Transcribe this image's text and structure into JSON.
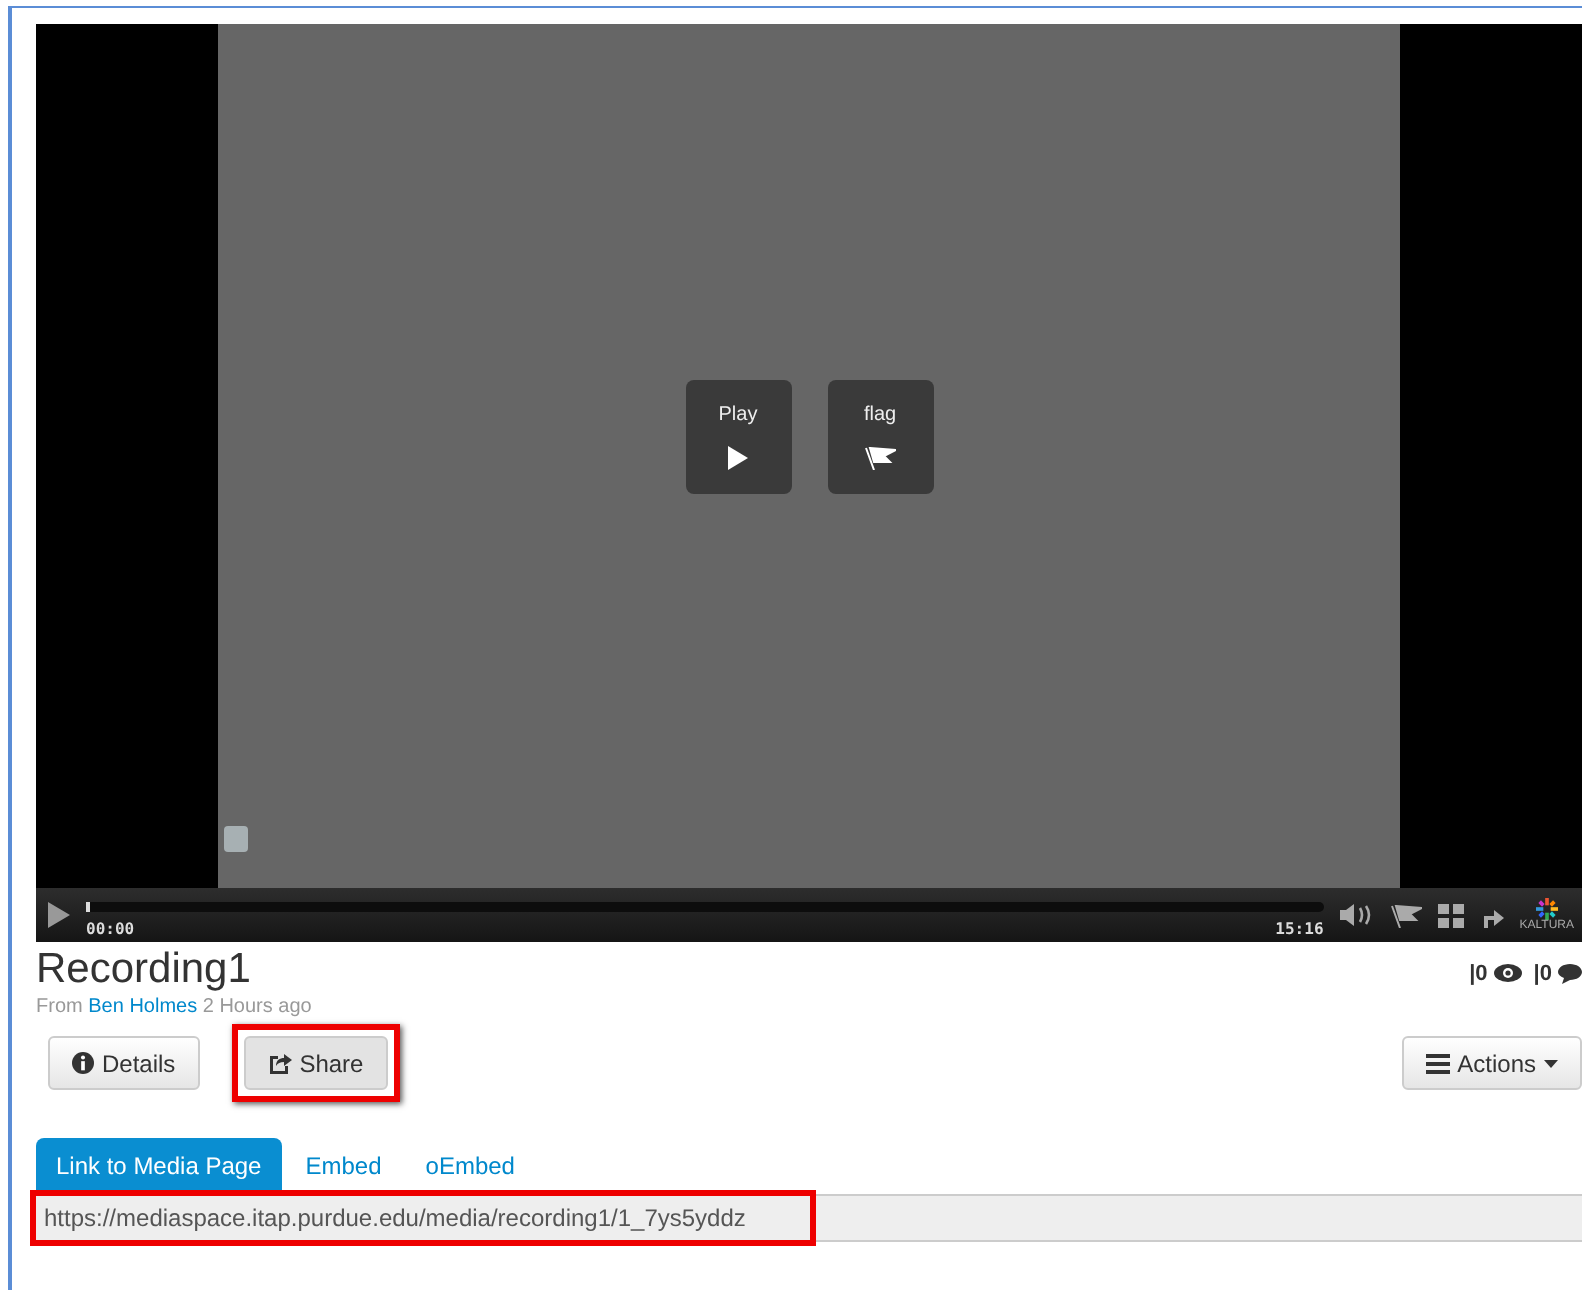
{
  "player": {
    "overlay_buttons": [
      {
        "kind": "play",
        "label": "Play"
      },
      {
        "kind": "flag",
        "label": "flag"
      }
    ],
    "current_time": "00:00",
    "duration": "15:16",
    "level": 0.003,
    "brand": "KALTURA"
  },
  "media": {
    "title": "Recording1",
    "from_label": "From",
    "author": "Ben Holmes",
    "age": "2 Hours ago",
    "stats": [
      {
        "kind": "views",
        "count": "|0"
      },
      {
        "kind": "comments",
        "count": "|0"
      }
    ]
  },
  "buttons": [
    {
      "kind": "details",
      "label": "Details",
      "highlighted": false
    },
    {
      "kind": "share",
      "label": "Share",
      "highlighted": true
    }
  ],
  "actions_button": {
    "label": "Actions"
  },
  "share_tabs": [
    {
      "label": "Link to Media Page",
      "selected": true
    },
    {
      "label": "Embed",
      "selected": false
    },
    {
      "label": "oEmbed",
      "selected": false
    }
  ],
  "link_field": {
    "value": "https://mediaspace.itap.purdue.edu/media/recording1/1_7ys5yddz",
    "highlighted": true
  }
}
